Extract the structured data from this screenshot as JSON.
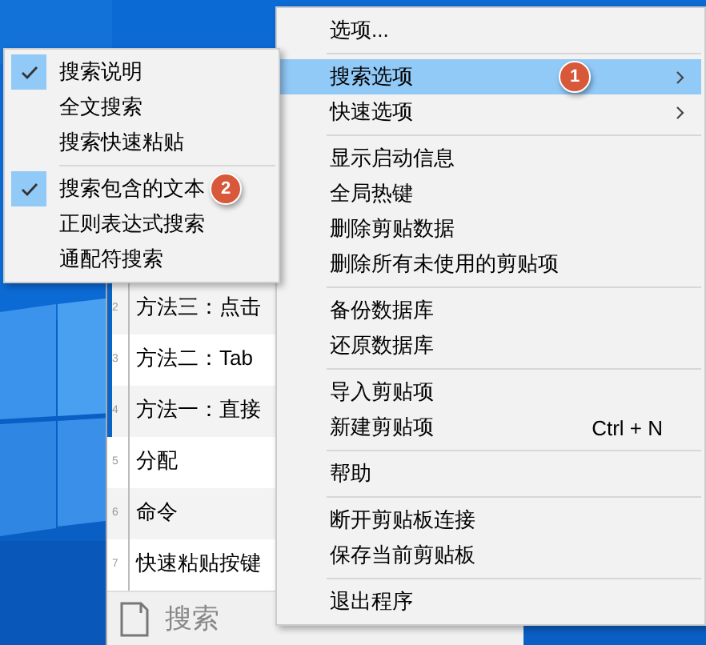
{
  "clip_list": {
    "rows": [
      {
        "number": "2",
        "text": "方法三：点击",
        "marked": true
      },
      {
        "number": "3",
        "text": "方法二：Tab",
        "marked": true
      },
      {
        "number": "4",
        "text": "方法一：直接",
        "marked": true
      },
      {
        "number": "5",
        "text": "分配",
        "marked": false
      },
      {
        "number": "6",
        "text": "命令",
        "marked": false
      },
      {
        "number": "7",
        "text": "快速粘贴按键",
        "marked": false
      }
    ],
    "search": {
      "placeholder": "搜索"
    }
  },
  "context_menu": {
    "items": [
      {
        "kind": "item",
        "label": "选项...",
        "selected": false
      },
      {
        "kind": "separator"
      },
      {
        "kind": "item",
        "label": "搜索选项",
        "selected": true,
        "has_submenu": true,
        "badge": "1"
      },
      {
        "kind": "item",
        "label": "快速选项",
        "selected": false,
        "has_submenu": true
      },
      {
        "kind": "separator"
      },
      {
        "kind": "item",
        "label": "显示启动信息",
        "selected": false
      },
      {
        "kind": "item",
        "label": "全局热键",
        "selected": false
      },
      {
        "kind": "item",
        "label": "删除剪贴数据",
        "selected": false
      },
      {
        "kind": "item",
        "label": "删除所有未使用的剪贴项",
        "selected": false
      },
      {
        "kind": "separator"
      },
      {
        "kind": "item",
        "label": "备份数据库",
        "selected": false
      },
      {
        "kind": "item",
        "label": "还原数据库",
        "selected": false
      },
      {
        "kind": "separator"
      },
      {
        "kind": "item",
        "label": "导入剪贴项",
        "selected": false
      },
      {
        "kind": "item",
        "label": "新建剪贴项",
        "selected": false,
        "shortcut": "Ctrl + N"
      },
      {
        "kind": "separator"
      },
      {
        "kind": "item",
        "label": "帮助",
        "selected": false
      },
      {
        "kind": "separator"
      },
      {
        "kind": "item",
        "label": "断开剪贴板连接",
        "selected": false
      },
      {
        "kind": "item",
        "label": "保存当前剪贴板",
        "selected": false
      },
      {
        "kind": "separator"
      },
      {
        "kind": "item",
        "label": "退出程序",
        "selected": false
      }
    ]
  },
  "submenu": {
    "items": [
      {
        "kind": "item",
        "label": "搜索说明",
        "checked": true
      },
      {
        "kind": "item",
        "label": "全文搜索",
        "checked": false
      },
      {
        "kind": "item",
        "label": "搜索快速粘贴",
        "checked": false
      },
      {
        "kind": "separator"
      },
      {
        "kind": "item",
        "label": "搜索包含的文本",
        "checked": true,
        "badge": "2"
      },
      {
        "kind": "item",
        "label": "正则表达式搜索",
        "checked": false
      },
      {
        "kind": "item",
        "label": "通配符搜索",
        "checked": false
      }
    ]
  }
}
